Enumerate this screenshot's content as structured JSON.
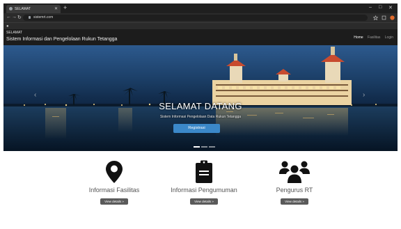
{
  "browser": {
    "tab_title": "SELAMAT",
    "new_tab": "+",
    "address": "sistemrt.com",
    "window_controls": [
      "–",
      "□",
      "✕"
    ]
  },
  "site": {
    "small_heading": "SELAMAT",
    "title": "Sistem Informasi dan Pengelolaan Rukun Tetangga",
    "nav": [
      "Home",
      "Fasilitas",
      "Login"
    ]
  },
  "hero": {
    "title": "SELAMAT DATANG",
    "subtitle": "Sistem Informasi Pengelolaan Data Rukun Tetangga",
    "button": "Registrasi",
    "prev": "‹",
    "next": "›"
  },
  "features": [
    {
      "icon": "map-pin-icon",
      "label": "Informasi Fasilitas",
      "button": "View details »"
    },
    {
      "icon": "clipboard-icon",
      "label": "Informasi Pengumuman",
      "button": "View details »"
    },
    {
      "icon": "users-icon",
      "label": "Pengurus RT",
      "button": "View details »"
    }
  ],
  "colors": {
    "accent": "#3b88c9",
    "header": "#1c1c1c",
    "button_grey": "#5a5a5a"
  }
}
